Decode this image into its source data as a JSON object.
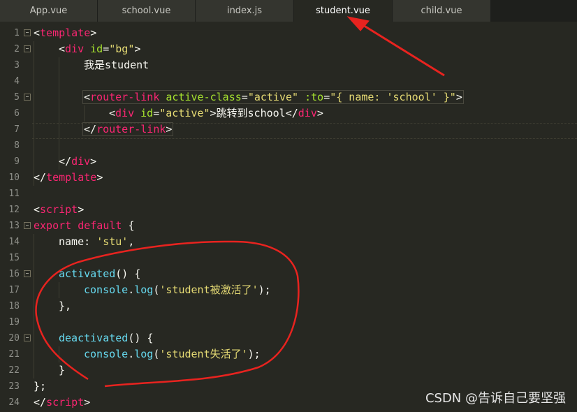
{
  "tabs": [
    {
      "label": "App.vue",
      "active": false
    },
    {
      "label": "school.vue",
      "active": false
    },
    {
      "label": "index.js",
      "active": false
    },
    {
      "label": "student.vue",
      "active": true
    },
    {
      "label": "child.vue",
      "active": false
    }
  ],
  "line_numbers": [
    "1",
    "2",
    "3",
    "4",
    "5",
    "6",
    "7",
    "8",
    "9",
    "10",
    "11",
    "12",
    "13",
    "14",
    "15",
    "16",
    "17",
    "18",
    "19",
    "20",
    "21",
    "22",
    "23",
    "24"
  ],
  "code": {
    "l1_open": "<",
    "l1_tag": "template",
    "l1_close": ">",
    "l2_open": "<",
    "l2_tag": "div",
    "l2_attr": " id",
    "l2_eq": "=",
    "l2_val": "\"bg\"",
    "l2_close": ">",
    "l3_text": "我是student",
    "l5_open": "<",
    "l5_tag": "router-link",
    "l5_attr1": " active-class",
    "l5_eq1": "=",
    "l5_val1": "\"active\"",
    "l5_attr2": " :to",
    "l5_eq2": "=",
    "l5_q1": "\"{ name: ",
    "l5_sv": "'school'",
    "l5_q2": " }\"",
    "l5_close": ">",
    "l6_open": "<",
    "l6_tag": "div",
    "l6_attr": " id",
    "l6_eq": "=",
    "l6_val": "\"active\"",
    "l6_gt": ">",
    "l6_text": "跳转到school",
    "l6_end_open": "</",
    "l6_end_tag": "div",
    "l6_end_close": ">",
    "l7_open": "</",
    "l7_tag": "router-link",
    "l7_close": ">",
    "l9_open": "</",
    "l9_tag": "div",
    "l9_close": ">",
    "l10_open": "</",
    "l10_tag": "template",
    "l10_close": ">",
    "l12_open": "<",
    "l12_tag": "script",
    "l12_close": ">",
    "l13_kw1": "export",
    "l13_kw2": " default",
    "l13_rest": " {",
    "l14_key": "name",
    "l14_colon": ": ",
    "l14_val": "'stu'",
    "l14_comma": ",",
    "l16_fn": "activated",
    "l16_rest": "() {",
    "l17_obj": "console",
    "l17_dot": ".",
    "l17_fn": "log",
    "l17_p1": "(",
    "l17_str": "'student被激活了'",
    "l17_p2": ");",
    "l18_text": "},",
    "l20_fn": "deactivated",
    "l20_rest": "() {",
    "l21_obj": "console",
    "l21_dot": ".",
    "l21_fn": "log",
    "l21_p1": "(",
    "l21_str": "'student失活了'",
    "l21_p2": ");",
    "l22_text": "}",
    "l23_text": "};",
    "l24_open": "</",
    "l24_tag": "script",
    "l24_close": ">"
  },
  "watermark": "CSDN @告诉自己要坚强",
  "colors": {
    "background": "#272822",
    "tag": "#f92672",
    "attr": "#a6e22e",
    "string": "#e6db74",
    "function": "#66d9ef",
    "annotation": "#e8231f"
  }
}
